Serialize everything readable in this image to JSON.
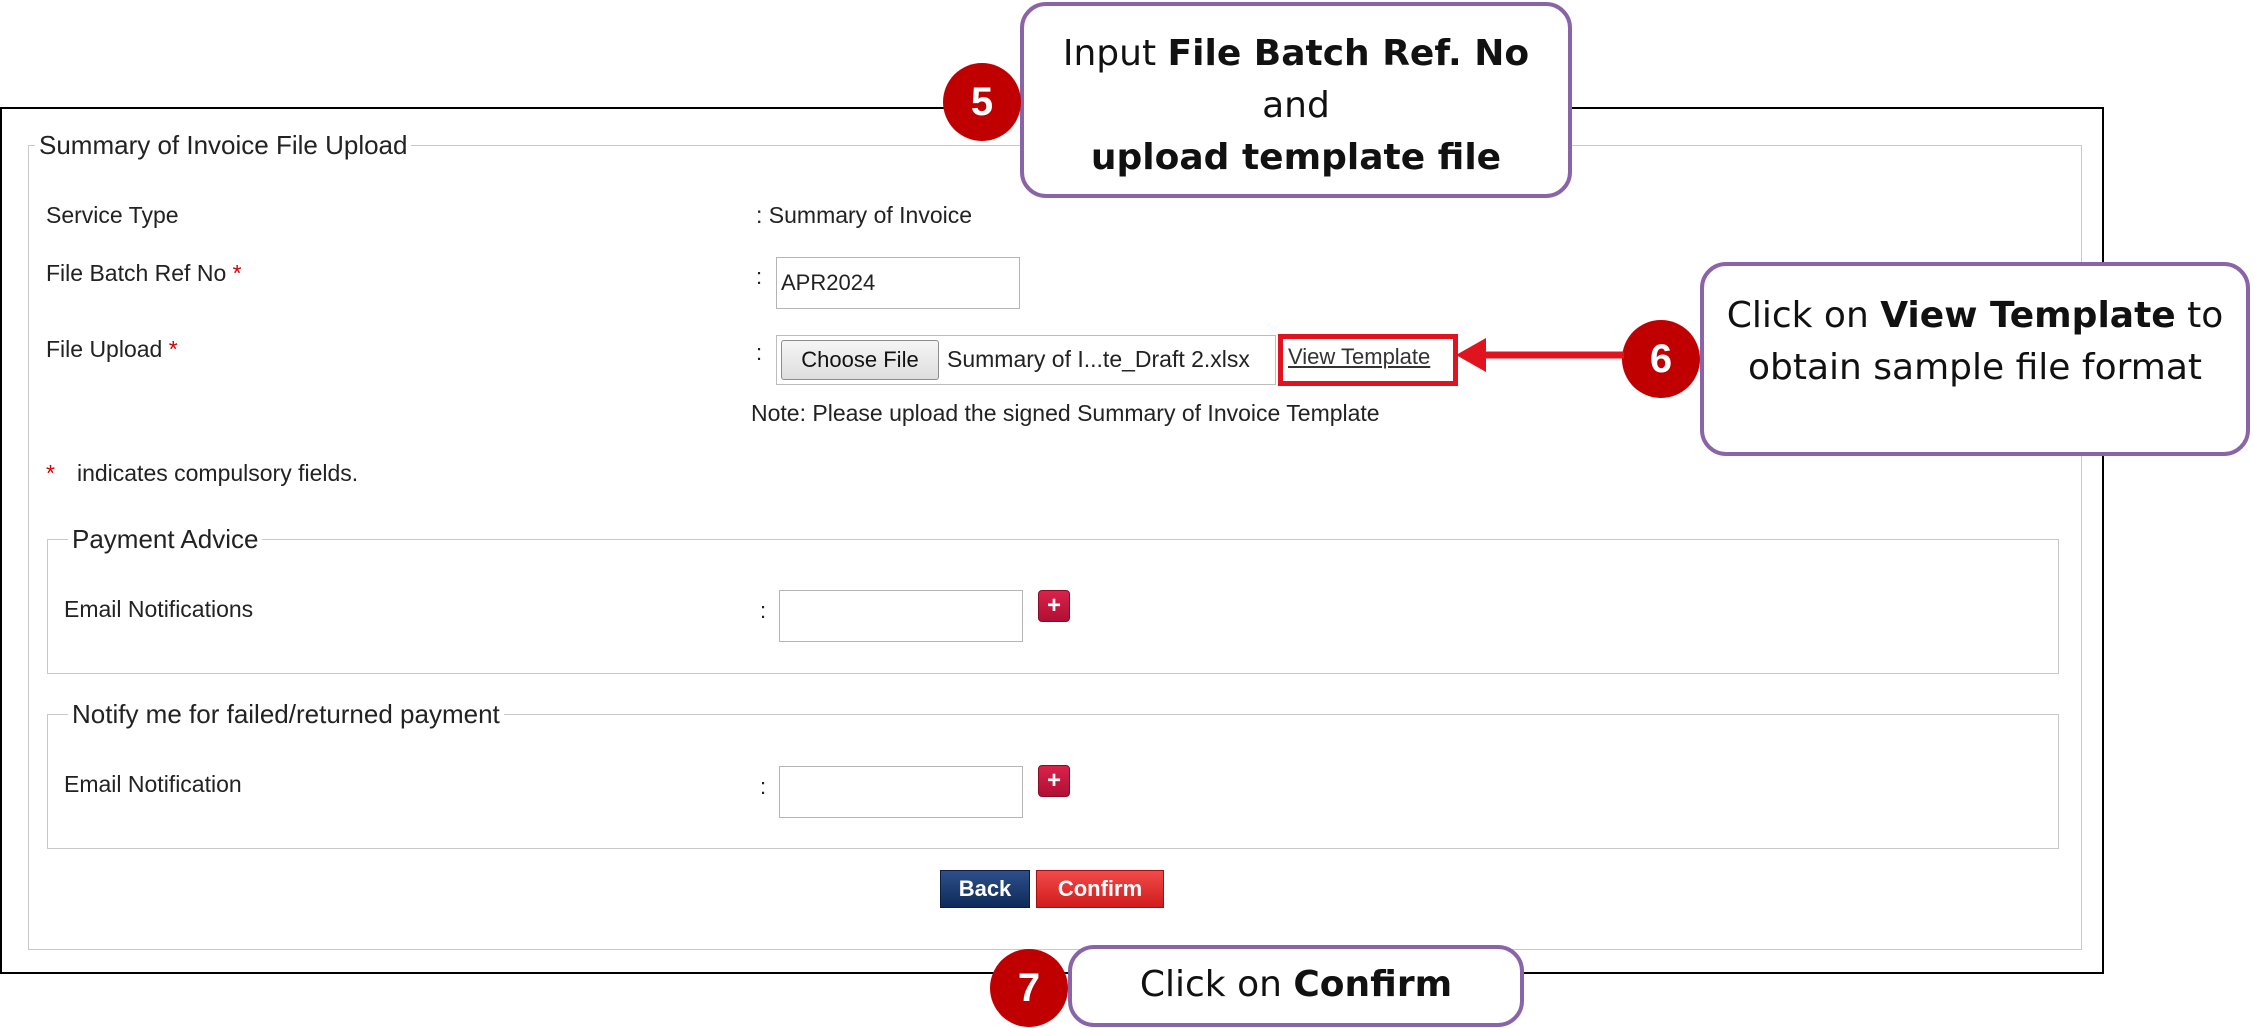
{
  "form": {
    "title": "Summary of Invoice File Upload",
    "service_type_label": "Service Type",
    "service_type_value": ": Summary of Invoice",
    "batch_label": "File Batch Ref No",
    "batch_value": "APR2024",
    "file_upload_label": "File Upload",
    "choose_file_label": "Choose File",
    "file_name": "Summary of I...te_Draft 2.xlsx",
    "view_template": "View Template",
    "note": "Note: Please upload the signed Summary of Invoice Template",
    "required_mark": "*",
    "compulsory_note": "indicates compulsory fields.",
    "colon": ":"
  },
  "payment_advice": {
    "title": "Payment Advice",
    "email_label": "Email Notifications",
    "add_symbol": "+"
  },
  "notify_failed": {
    "title": "Notify me for failed/returned payment",
    "email_label": "Email Notification",
    "add_symbol": "+"
  },
  "buttons": {
    "back": "Back",
    "confirm": "Confirm"
  },
  "callouts": {
    "step5": {
      "number": "5",
      "text_pre": "Input ",
      "text_bold1": "File Batch Ref. No",
      "text_mid": " and",
      "text_bold2": "upload template file"
    },
    "step6": {
      "number": "6",
      "text_pre": "Click on ",
      "text_bold": "View Template",
      "text_post": " to",
      "text_line2": "obtain sample file format"
    },
    "step7": {
      "number": "7",
      "text_pre": "Click on ",
      "text_bold": "Confirm"
    }
  },
  "colors": {
    "required": "#d00000",
    "highlight": "#e0141e",
    "callout_border": "#8a64a8",
    "badge": "#c00000",
    "back_button": "#1a3a70",
    "confirm_button": "#e03030",
    "add_button": "#c81a40"
  }
}
